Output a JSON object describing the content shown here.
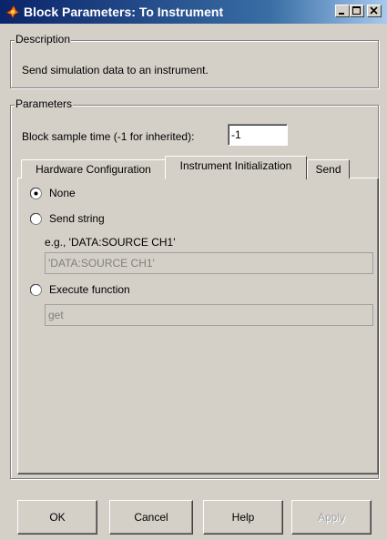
{
  "window": {
    "title": "Block Parameters: To Instrument",
    "icon": "simulink-block-icon",
    "controls": [
      "minimize-icon",
      "maximize-icon",
      "close-icon"
    ]
  },
  "description": {
    "group_label": "Description",
    "text": "Send simulation data to an instrument."
  },
  "parameters": {
    "group_label": "Parameters",
    "sample_time_label": "Block sample time (-1 for inherited):",
    "sample_time_value": "-1"
  },
  "tabs": [
    {
      "label": "Hardware Configuration",
      "active": false
    },
    {
      "label": "Instrument Initialization",
      "active": true
    },
    {
      "label": "Send",
      "active": false
    }
  ],
  "init_options": {
    "none_label": "None",
    "send_string_label": "Send string",
    "example_text": "e.g., 'DATA:SOURCE CH1'",
    "send_string_value": "'DATA:SOURCE CH1'",
    "execute_function_label": "Execute function",
    "function_value": "get",
    "selected": "None"
  },
  "buttons": {
    "ok": "OK",
    "cancel": "Cancel",
    "help": "Help",
    "apply": "Apply"
  },
  "colors": {
    "title_bar_start": "#0a246a",
    "title_bar_end": "#a6caf0",
    "dialog_face": "#d4d0c8"
  }
}
